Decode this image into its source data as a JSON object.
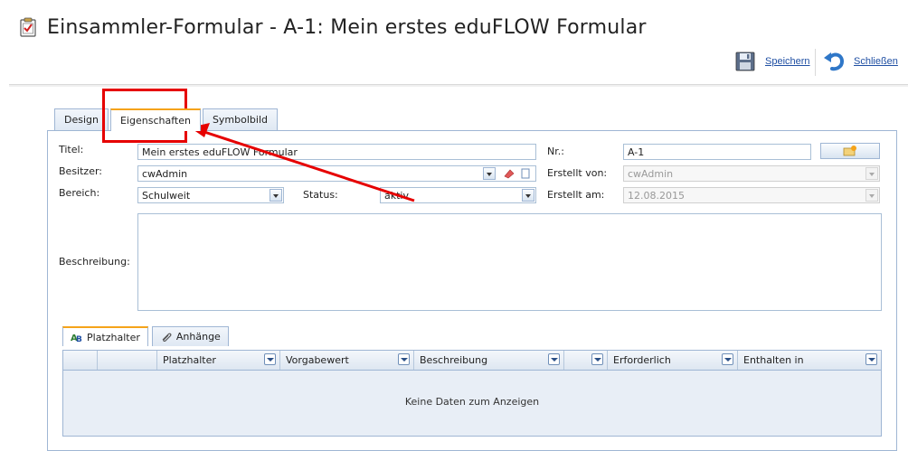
{
  "window": {
    "title": "Einsammler-Formular - A-1: Mein erstes eduFLOW Formular"
  },
  "toolbar": {
    "save_label": "Speichern",
    "close_label": "Schließen"
  },
  "tabs": [
    {
      "label": "Design",
      "active": false
    },
    {
      "label": "Eigenschaften",
      "active": true
    },
    {
      "label": "Symbolbild",
      "active": false
    }
  ],
  "form": {
    "titel_label": "Titel:",
    "titel_value": "Mein erstes eduFLOW Formular",
    "besitzer_label": "Besitzer:",
    "besitzer_value": "cwAdmin",
    "bereich_label": "Bereich:",
    "bereich_value": "Schulweit",
    "status_label": "Status:",
    "status_value": "aktiv",
    "nr_label": "Nr.:",
    "nr_value": "A-1",
    "erstellt_von_label": "Erstellt von:",
    "erstellt_von_value": "cwAdmin",
    "erstellt_am_label": "Erstellt am:",
    "erstellt_am_value": "12.08.2015",
    "beschreibung_label": "Beschreibung:"
  },
  "subtabs": [
    {
      "label": "Platzhalter",
      "active": true,
      "icon": "placeholder-icon"
    },
    {
      "label": "Anhänge",
      "active": false,
      "icon": "paperclip-icon"
    }
  ],
  "grid": {
    "columns": [
      "Platzhalter",
      "Vorgabewert",
      "Beschreibung",
      "",
      "Erforderlich",
      "Enthalten in"
    ],
    "empty_message": "Keine Daten zum Anzeigen"
  },
  "colors": {
    "accent_tab": "#f5a31a",
    "border_blue": "#9fb6d4",
    "annotation_red": "#e60000",
    "link_blue": "#1f4fa3"
  }
}
